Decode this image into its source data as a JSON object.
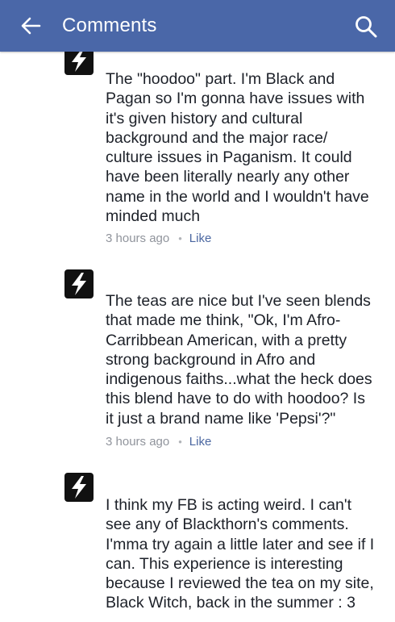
{
  "header": {
    "title": "Comments",
    "color": "#4a67a8",
    "back_icon": "arrow-left-icon",
    "search_icon": "search-icon"
  },
  "comments": [
    {
      "avatar": "lightning-bolt-avatar",
      "text": "The \"hoodoo\" part. I'm Black and\nPagan so I'm gonna have issues with\nit's given history and cultural\nbackground and the major race/\nculture issues in Paganism. It could\nhave been literally nearly any other\nname in the world and I wouldn't have\nminded much",
      "time": "3 hours ago",
      "separator": "•",
      "like_label": "Like"
    },
    {
      "avatar": "lightning-bolt-avatar",
      "text": "The teas are nice but I've seen blends\nthat made me think, \"Ok, I'm Afro-\nCarribbean American, with a pretty\nstrong background in Afro and\nindigenous faiths...what the heck does\nthis blend have to do with hoodoo? Is\nit just a brand name like 'Pepsi'?\"",
      "time": "3 hours ago",
      "separator": "•",
      "like_label": "Like"
    },
    {
      "avatar": "lightning-bolt-avatar",
      "text": "I think my FB is acting weird. I can't\nsee any of Blackthorn's comments.\nI'mma try again a little later and see if I\ncan. This experience is interesting\nbecause I reviewed the tea on my site,\nBlack Witch, back in the summer : 3"
    }
  ]
}
